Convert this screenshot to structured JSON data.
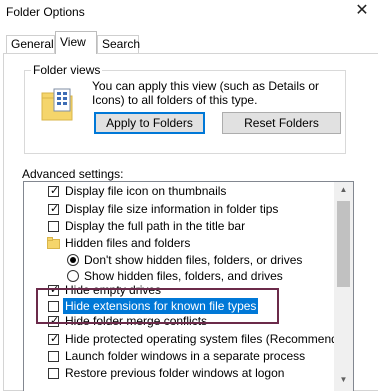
{
  "window": {
    "title": "Folder Options"
  },
  "tabs": [
    {
      "label": "General"
    },
    {
      "label": "View"
    },
    {
      "label": "Search"
    }
  ],
  "folder_views": {
    "label": "Folder views",
    "description": "You can apply this view (such as Details or Icons) to all folders of this type.",
    "apply_button": "Apply to Folders",
    "reset_button": "Reset Folders"
  },
  "advanced": {
    "label": "Advanced settings:",
    "items": [
      {
        "label": "Display file icon on thumbnails",
        "type": "checkbox",
        "checked": true
      },
      {
        "label": "Display file size information in folder tips",
        "type": "checkbox",
        "checked": true
      },
      {
        "label": "Display the full path in the title bar",
        "type": "checkbox",
        "checked": false
      },
      {
        "label": "Hidden files and folders",
        "type": "folder"
      },
      {
        "label": "Don't show hidden files, folders, or drives",
        "type": "radio",
        "checked": true
      },
      {
        "label": "Show hidden files, folders, and drives",
        "type": "radio",
        "checked": false
      },
      {
        "label": "Hide empty drives",
        "type": "checkbox",
        "checked": true
      },
      {
        "label": "Hide extensions for known file types",
        "type": "checkbox",
        "checked": false,
        "selected": true
      },
      {
        "label": "Hide folder merge conflicts",
        "type": "checkbox",
        "checked": true
      },
      {
        "label": "Hide protected operating system files (Recommended)",
        "type": "checkbox",
        "checked": true
      },
      {
        "label": "Launch folder windows in a separate process",
        "type": "checkbox",
        "checked": false
      },
      {
        "label": "Restore previous folder windows at logon",
        "type": "checkbox",
        "checked": false
      }
    ]
  },
  "icons": {
    "close": "close-icon",
    "tick": "checkmark-icon"
  },
  "colors": {
    "selection": "#0078d7",
    "highlight_box": "#6b2a4a",
    "folder": "#f5d56b"
  }
}
